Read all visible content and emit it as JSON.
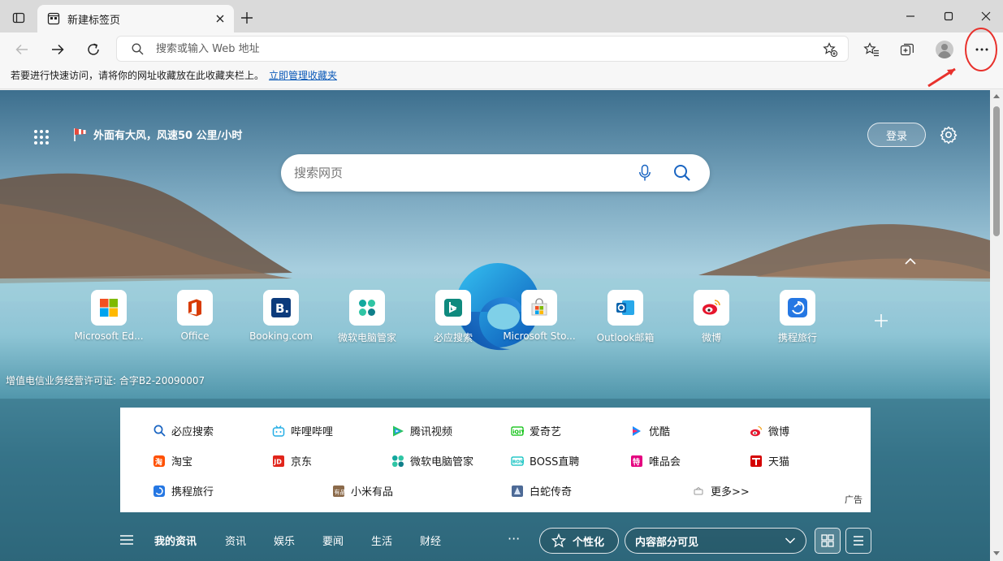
{
  "browser": {
    "tab_title": "新建标签页",
    "address_placeholder": "搜索或输入 Web 地址"
  },
  "favorites_bar": {
    "message": "若要进行快速访问，请将你的网址收藏放在此收藏夹栏上。",
    "manage_link": "立即管理收藏夹"
  },
  "newtab": {
    "weather": "外面有大风，风速50 公里/小时",
    "login": "登录",
    "search_placeholder": "搜索网页",
    "license": "增值电信业务经营许可证: 合字B2-20090007"
  },
  "quick_links": [
    {
      "label": "Microsoft Ed...",
      "icon": "microsoft-logo-icon"
    },
    {
      "label": "Office",
      "icon": "office-icon"
    },
    {
      "label": "Booking.com",
      "icon": "booking-icon"
    },
    {
      "label": "微软电脑管家",
      "icon": "pc-manager-icon"
    },
    {
      "label": "必应搜索",
      "icon": "bing-icon"
    },
    {
      "label": "Microsoft Sto...",
      "icon": "store-icon"
    },
    {
      "label": "Outlook邮箱",
      "icon": "outlook-icon"
    },
    {
      "label": "微博",
      "icon": "weibo-icon"
    },
    {
      "label": "携程旅行",
      "icon": "ctrip-icon"
    }
  ],
  "links_panel": {
    "rows": [
      [
        "必应搜索",
        "哔哩哔哩",
        "腾讯视频",
        "爱奇艺",
        "优酷",
        "微博"
      ],
      [
        "淘宝",
        "京东",
        "微软电脑管家",
        "BOSS直聘",
        "唯品会",
        "天猫"
      ],
      [
        "携程旅行",
        "小米有品",
        "白蛇传奇",
        "更多>>"
      ]
    ],
    "ad_label": "广告"
  },
  "feed": {
    "tabs": [
      "我的资讯",
      "资讯",
      "娱乐",
      "要闻",
      "生活",
      "财经"
    ],
    "more": "···",
    "personalize": "个性化",
    "content_visibility": "内容部分可见"
  },
  "colors": {
    "accent": "#0a59b8",
    "annotation": "#e8312c"
  }
}
